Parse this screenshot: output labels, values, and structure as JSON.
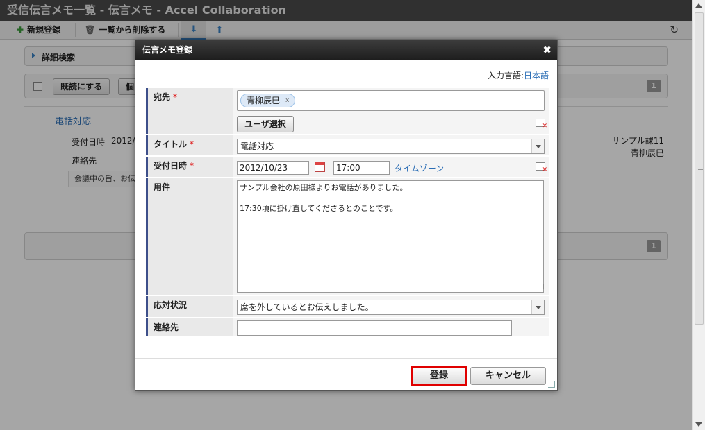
{
  "app": {
    "title": "受信伝言メモ一覧 - 伝言メモ - Accel Collaboration"
  },
  "toolbar": {
    "new_label": "新規登録",
    "delete_label": "一覧から削除する"
  },
  "list": {
    "advanced_search": "詳細検索",
    "mark_read_label": "既読にする",
    "individual_label": "個",
    "page_number": "1",
    "bottom_page_number": "1"
  },
  "record": {
    "title": "電話対応",
    "received_label": "受付日時",
    "received_value": "2012/",
    "contact_label": "連絡先",
    "note_excerpt": "会議中の旨、お伝",
    "section": "サンプル課11",
    "person": "青柳辰巳"
  },
  "dialog": {
    "title": "伝言メモ登録",
    "close_glyph": "✖",
    "input_lang_label": "入力言語:",
    "input_lang_value": "日本語",
    "fields": {
      "to_label": "宛先",
      "required_mark": "*",
      "to_chip_name": "青柳辰巳",
      "to_chip_remove": "x",
      "user_select_label": "ユーザ選択",
      "title_label": "タイトル",
      "title_value": "電話対応",
      "date_label": "受付日時",
      "date_value": "2012/10/23",
      "time_value": "17:00",
      "timezone_link": "タイムゾーン",
      "content_label": "用件",
      "content_value": "サンプル会社の原田様よりお電話がありました。\n\n17:30頃に掛け直してくださるとのことです。",
      "status_label": "応対状況",
      "status_value": "席を外しているとお伝えしました。",
      "contact_label": "連絡先",
      "contact_value": ""
    },
    "register_label": "登録",
    "cancel_label": "キャンセル"
  }
}
